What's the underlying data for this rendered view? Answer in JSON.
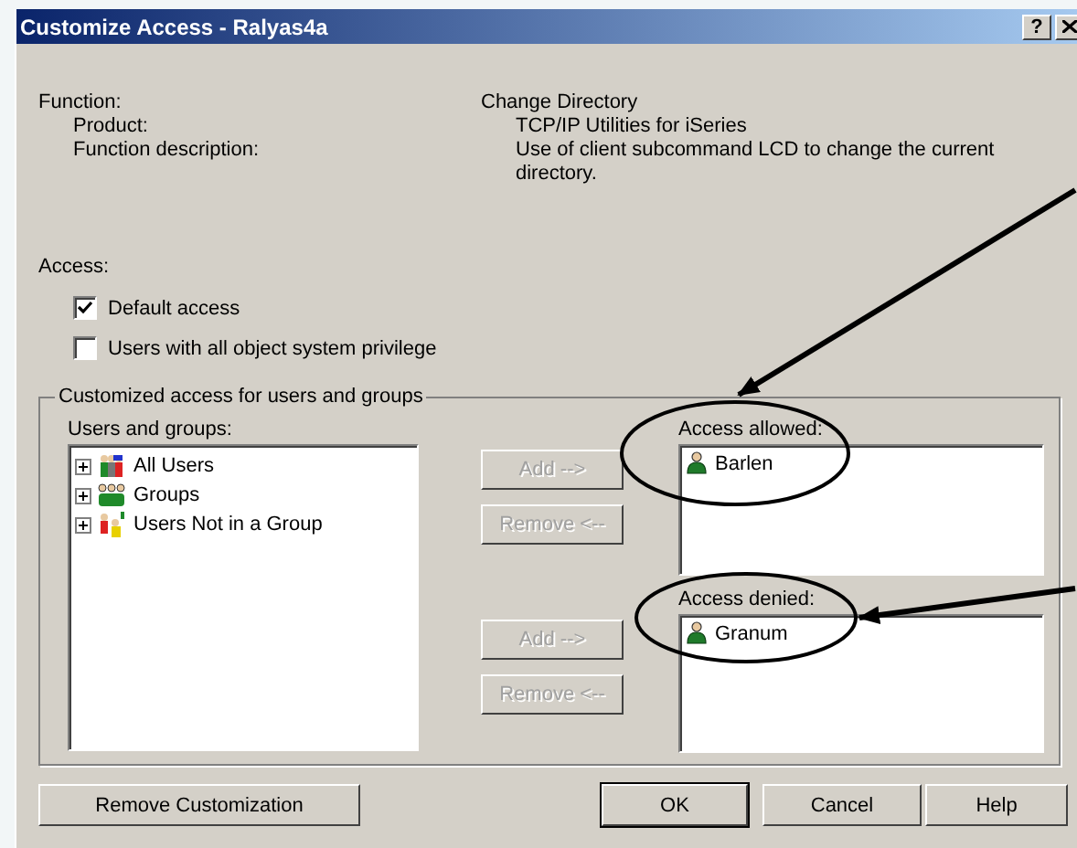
{
  "window": {
    "title": "Customize Access - Ralyas4a",
    "help_button": "?"
  },
  "function": {
    "label": "Function:",
    "value": "Change Directory",
    "details": [
      {
        "label": "Product:",
        "value": "TCP/IP Utilities for iSeries"
      },
      {
        "label": "Function description:",
        "value": "Use of client subcommand LCD to change the current directory."
      }
    ]
  },
  "access": {
    "label": "Access:",
    "options": [
      {
        "label": "Default access",
        "checked": true
      },
      {
        "label": "Users with all object system privilege",
        "checked": false
      }
    ]
  },
  "customized": {
    "title": "Customized access for users and groups",
    "users_and_groups": {
      "label": "Users and groups:",
      "items": [
        {
          "label": "All Users",
          "kind": "all",
          "expanded": false
        },
        {
          "label": "Groups",
          "kind": "groups",
          "expanded": false
        },
        {
          "label": "Users Not in a Group",
          "kind": "ungrouped",
          "expanded": false
        }
      ]
    },
    "lists": [
      {
        "label": "Access allowed:",
        "add_button": {
          "label": "Add -->",
          "disabled": true
        },
        "remove_button": {
          "label": "Remove <--",
          "disabled": true
        },
        "items": [
          "Barlen"
        ]
      },
      {
        "label": "Access denied:",
        "add_button": {
          "label": "Add -->",
          "disabled": true
        },
        "remove_button": {
          "label": "Remove <--",
          "disabled": true
        },
        "items": [
          "Granum"
        ]
      }
    ]
  },
  "buttons": [
    {
      "label": "Remove Customization",
      "default": false
    },
    {
      "label": "OK",
      "default": true
    },
    {
      "label": "Cancel",
      "default": false
    },
    {
      "label": "Help",
      "default": false
    }
  ]
}
